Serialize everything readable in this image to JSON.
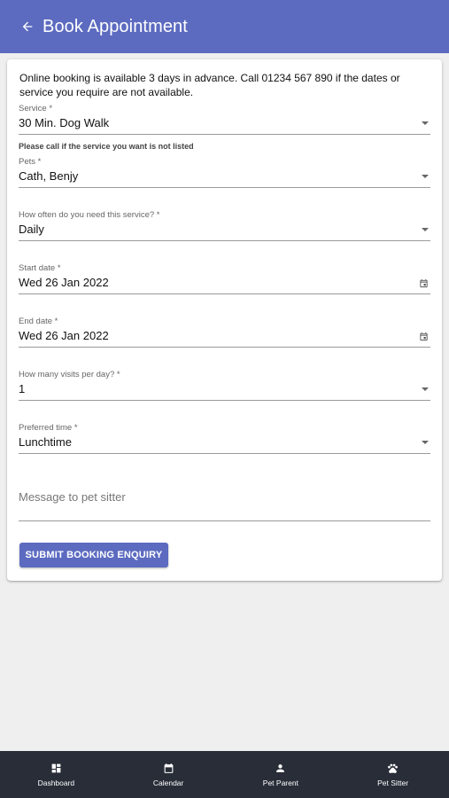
{
  "header": {
    "title": "Book Appointment"
  },
  "form": {
    "info": "Online booking is available 3 days in advance. Call 01234 567 890 if the dates or service you require are not available.",
    "service": {
      "label": "Service *",
      "value": "30 Min. Dog Walk",
      "helper": "Please call if the service you want is not listed"
    },
    "pets": {
      "label": "Pets *",
      "value": "Cath, Benjy"
    },
    "frequency": {
      "label": "How often do you need this service? *",
      "value": "Daily"
    },
    "start_date": {
      "label": "Start date *",
      "value": "Wed 26 Jan 2022"
    },
    "end_date": {
      "label": "End date *",
      "value": "Wed 26 Jan 2022"
    },
    "visits": {
      "label": "How many visits per day? *",
      "value": "1"
    },
    "preferred_time": {
      "label": "Preferred time *",
      "value": "Lunchtime"
    },
    "message": {
      "placeholder": "Message to pet sitter"
    },
    "submit_label": "SUBMIT BOOKING ENQUIRY"
  },
  "nav": {
    "items": [
      {
        "label": "Dashboard",
        "icon": "dashboard-icon"
      },
      {
        "label": "Calendar",
        "icon": "calendar-icon"
      },
      {
        "label": "Pet Parent",
        "icon": "person-icon"
      },
      {
        "label": "Pet Sitter",
        "icon": "paw-icon"
      }
    ]
  },
  "colors": {
    "primary": "#5c6bc0",
    "nav_bg": "#282d38",
    "page_bg": "#efefef"
  }
}
